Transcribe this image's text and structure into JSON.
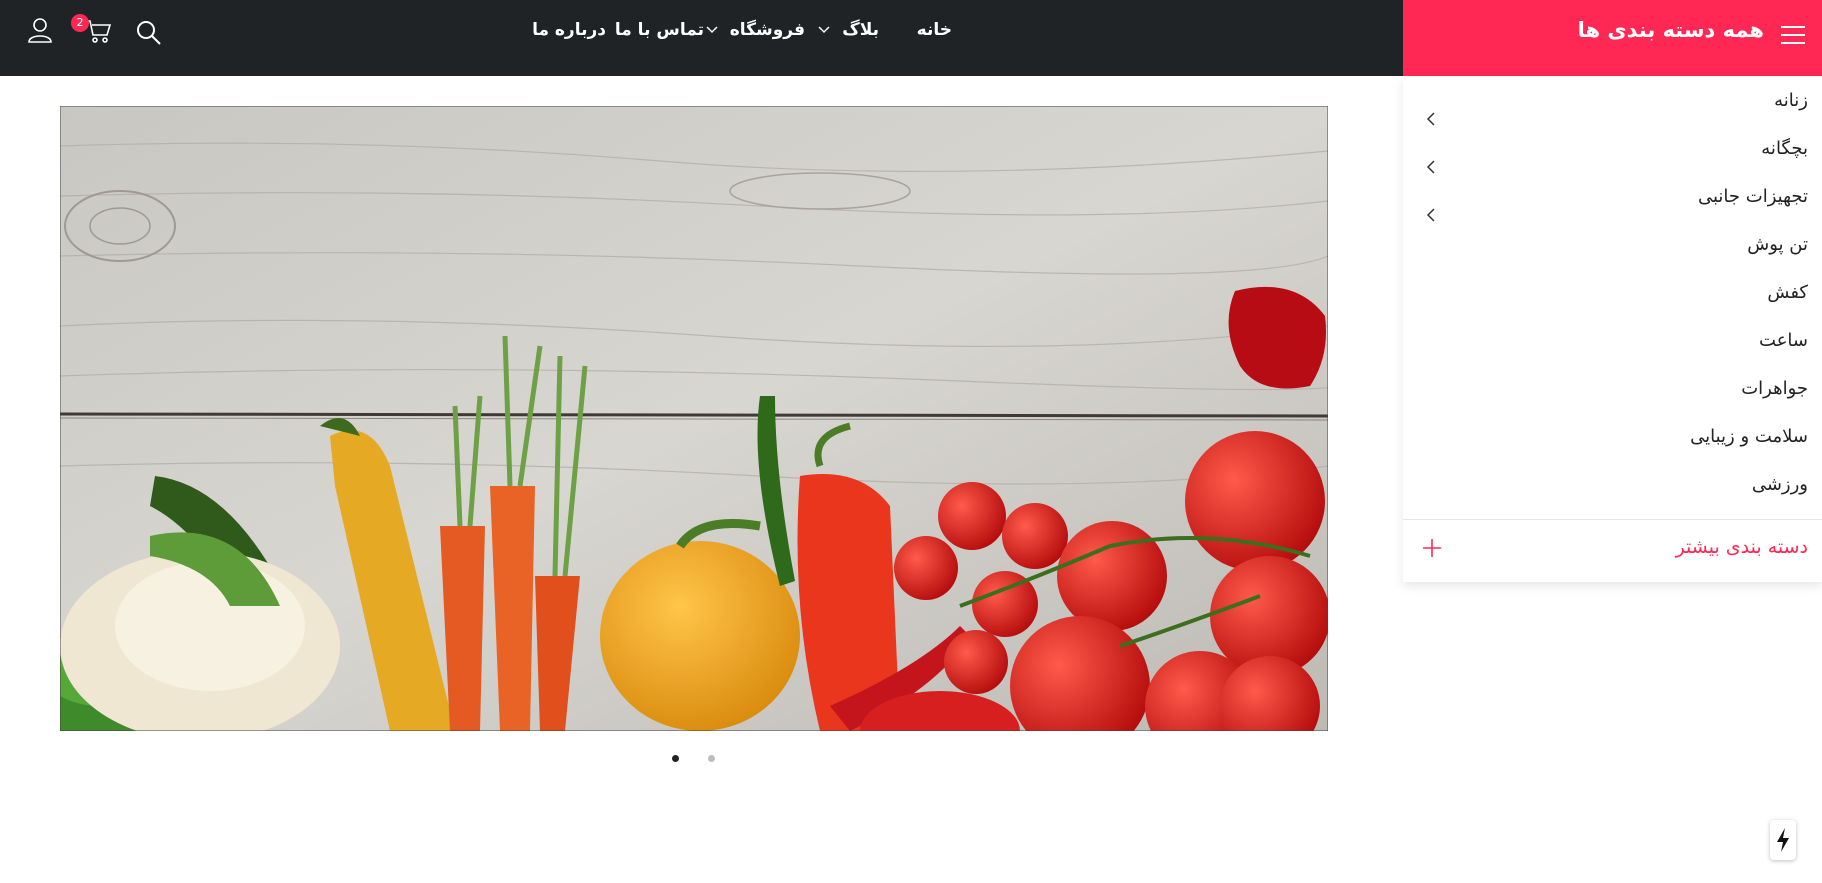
{
  "header": {
    "categories_title": "همه دسته بندی ها",
    "nav": [
      {
        "label": "خانه",
        "has_dropdown": false
      },
      {
        "label": "بلاگ",
        "has_dropdown": true
      },
      {
        "label": "فروشگاه",
        "has_dropdown": true
      },
      {
        "label": "تماس با ما",
        "has_dropdown": false
      },
      {
        "label": "درباره ما",
        "has_dropdown": false
      }
    ],
    "cart_count": "2",
    "icons": [
      "menu-icon",
      "search-icon",
      "cart-icon",
      "user-icon"
    ]
  },
  "categories": {
    "items": [
      {
        "label": "زنانه",
        "has_submenu": true
      },
      {
        "label": "بچگانه",
        "has_submenu": true
      },
      {
        "label": "تجهیزات جانبی",
        "has_submenu": true
      },
      {
        "label": "تن پوش",
        "has_submenu": false
      },
      {
        "label": "کفش",
        "has_submenu": false
      },
      {
        "label": "ساعت",
        "has_submenu": false
      },
      {
        "label": "جواهرات",
        "has_submenu": false
      },
      {
        "label": "سلامت و زیبایی",
        "has_submenu": false
      },
      {
        "label": "ورزشی",
        "has_submenu": false
      }
    ],
    "more_label": "دسته بندی بیشتر"
  },
  "slider": {
    "slide_count": 2,
    "active_slide": 1
  },
  "colors": {
    "topbar": "#1f2326",
    "accent": "#ff2855",
    "text": "#222222"
  }
}
